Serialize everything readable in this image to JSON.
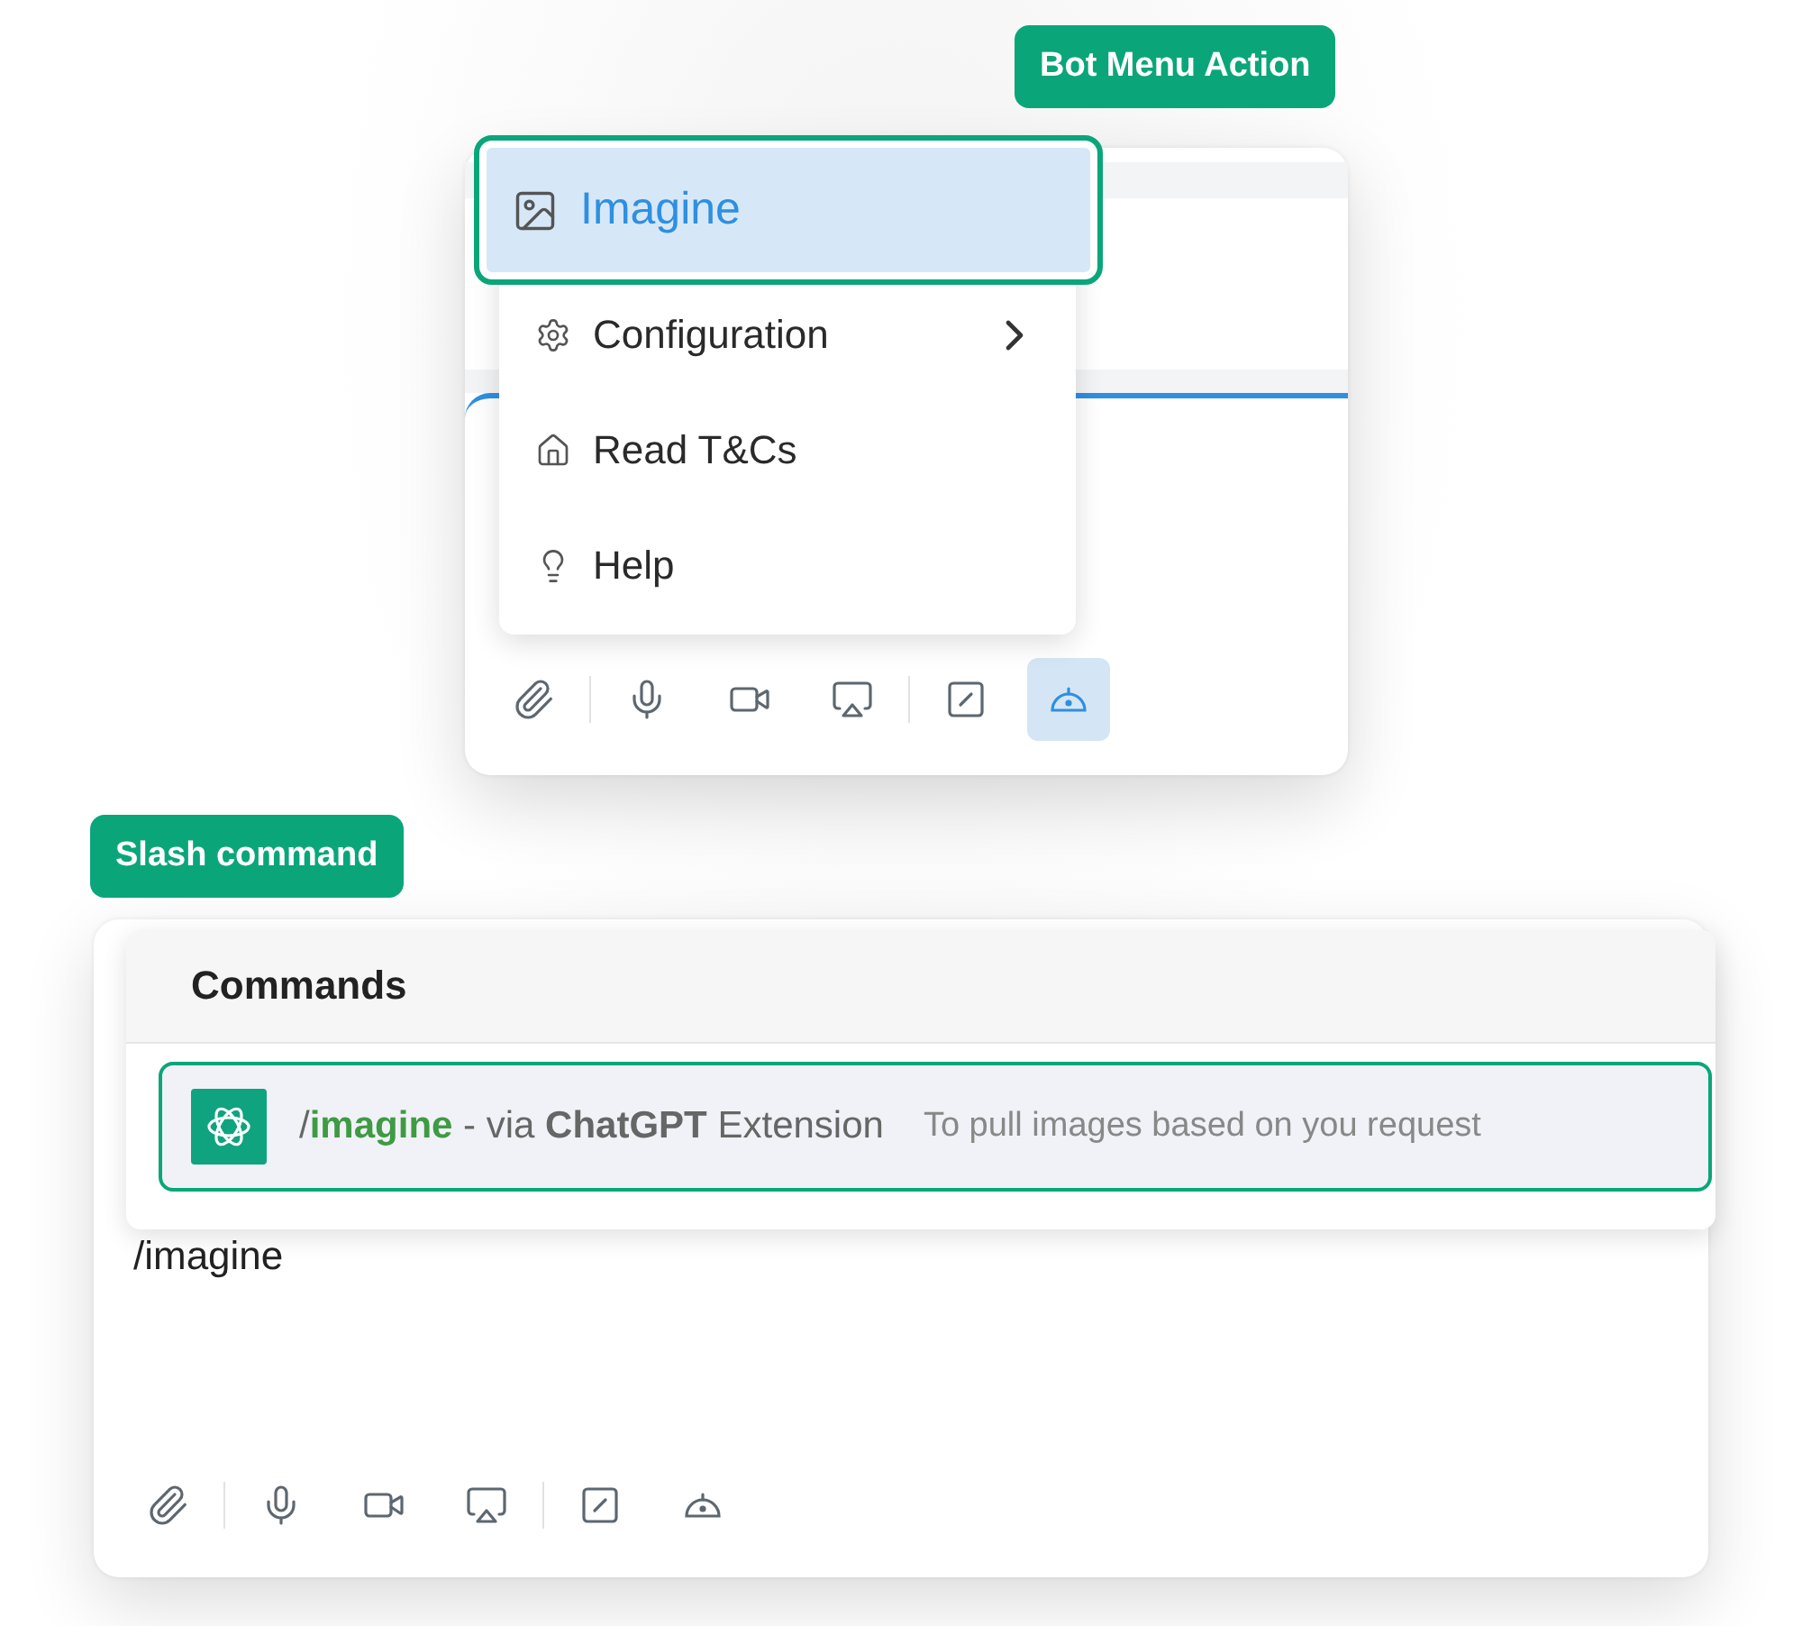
{
  "bot_menu_demo": {
    "label": "Bot Menu Action",
    "menu": [
      {
        "label": "Imagine",
        "kind": "image",
        "selected": true,
        "has_submenu": false
      },
      {
        "label": "Configuration",
        "kind": "gear",
        "selected": false,
        "has_submenu": true
      },
      {
        "label": "Read T&Cs",
        "kind": "home",
        "selected": false,
        "has_submenu": false
      },
      {
        "label": "Help",
        "kind": "bulb",
        "selected": false,
        "has_submenu": false
      }
    ],
    "toolbar": [
      {
        "items": [
          {
            "kind": "paperclip",
            "selected": false
          }
        ]
      },
      {
        "items": [
          {
            "kind": "mic",
            "selected": false
          },
          {
            "kind": "video",
            "selected": false
          },
          {
            "kind": "screen",
            "selected": false
          }
        ]
      },
      {
        "items": [
          {
            "kind": "slash",
            "selected": false
          },
          {
            "kind": "bot",
            "selected": true
          }
        ]
      }
    ]
  },
  "slash_command_demo": {
    "label": "Slash command",
    "commands_title": "Commands",
    "commands": [
      {
        "title": "/**imagine** - via **ChatGPT** Extension",
        "description": "To pull images based on you request",
        "selected": true
      }
    ],
    "message": "/imagine",
    "toolbar": [
      {
        "items": [
          {
            "kind": "paperclip",
            "selected": false
          }
        ]
      },
      {
        "items": [
          {
            "kind": "mic",
            "selected": false
          },
          {
            "kind": "video",
            "selected": false
          },
          {
            "kind": "screen",
            "selected": false
          }
        ]
      },
      {
        "items": [
          {
            "kind": "slash",
            "selected": false
          },
          {
            "kind": "bot",
            "selected": false
          }
        ]
      }
    ]
  }
}
